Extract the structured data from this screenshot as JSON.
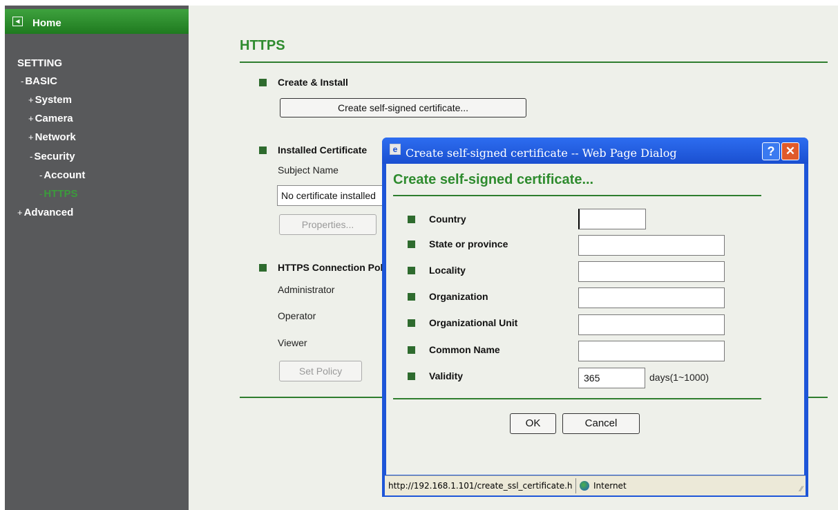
{
  "sidebar": {
    "home_label": "Home",
    "setting_label": "SETTING",
    "items": [
      {
        "marker": "-",
        "label": "BASIC"
      },
      {
        "marker": "+",
        "label": "System"
      },
      {
        "marker": "+",
        "label": "Camera"
      },
      {
        "marker": "+",
        "label": "Network"
      },
      {
        "marker": "-",
        "label": "Security"
      },
      {
        "marker": "-",
        "label": "Account"
      },
      {
        "marker": "-",
        "label": "HTTPS"
      },
      {
        "marker": "+",
        "label": "Advanced"
      }
    ],
    "active_item": "HTTPS",
    "active_color": "#3c9a3c"
  },
  "main": {
    "title": "HTTPS",
    "create_install": {
      "label": "Create & Install",
      "button_label": "Create self-signed certificate..."
    },
    "installed_certificate": {
      "label": "Installed Certificate",
      "subject_name_label": "Subject Name",
      "subject_value": "No certificate installed",
      "properties_button": "Properties..."
    },
    "connection_policy": {
      "label": "HTTPS Connection Policy",
      "administrator_label": "Administrator",
      "operator_label": "Operator",
      "viewer_label": "Viewer",
      "set_policy_button": "Set Policy"
    }
  },
  "dialog": {
    "window_title": "Create self-signed certificate -- Web Page Dialog",
    "heading": "Create self-signed certificate...",
    "fields": {
      "country": {
        "label": "Country",
        "value": ""
      },
      "state": {
        "label": "State or province",
        "value": ""
      },
      "locality": {
        "label": "Locality",
        "value": ""
      },
      "organization": {
        "label": "Organization",
        "value": ""
      },
      "org_unit": {
        "label": "Organizational Unit",
        "value": ""
      },
      "common_name": {
        "label": "Common Name",
        "value": ""
      },
      "validity": {
        "label": "Validity",
        "value": "365",
        "suffix": "days(1~1000)"
      }
    },
    "ok_label": "OK",
    "cancel_label": "Cancel",
    "help_glyph": "?",
    "close_glyph": "✕",
    "status_url": "http://192.168.1.101/create_ssl_certificate.h",
    "status_zone": "Internet"
  },
  "colors": {
    "accent_green": "#2e8b2e",
    "sidebar_bg": "#58595b",
    "titlebar_blue": "#1a4fd0"
  }
}
